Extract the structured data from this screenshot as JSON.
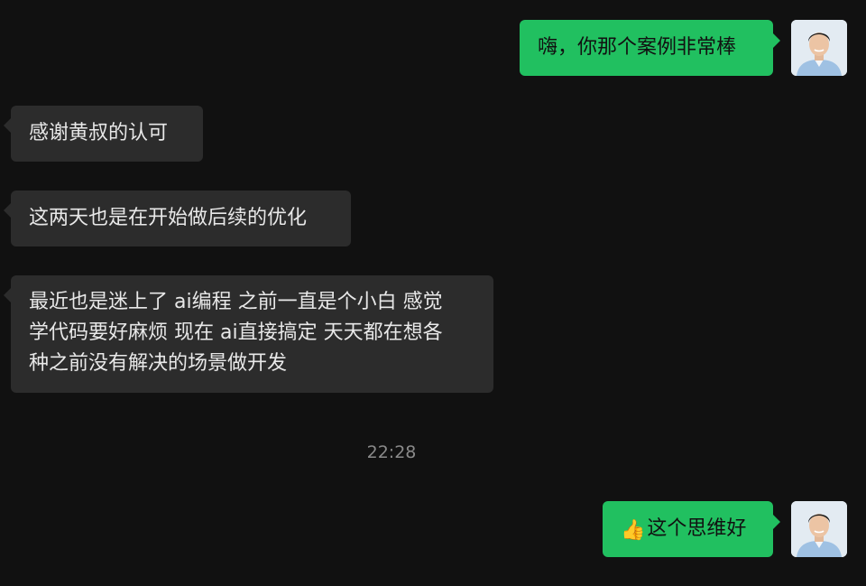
{
  "messages": [
    {
      "direction": "out",
      "text": "嗨，你那个案例非常棒"
    },
    {
      "direction": "in",
      "text": "感谢黄叔的认可"
    },
    {
      "direction": "in",
      "text": "这两天也是在开始做后续的优化"
    },
    {
      "direction": "in",
      "lines": [
        "最近也是迷上了 ai编程 之前一直是个小白 感觉",
        "学代码要好麻烦 现在 ai直接搞定 天天都在想各",
        "种之前没有解决的场景做开发"
      ]
    },
    {
      "direction": "out",
      "emoji": "👍",
      "text": "这个思维好"
    }
  ],
  "timestamp": "22:28",
  "colors": {
    "background": "#111111",
    "incoming_bubble": "#2c2c2c",
    "outgoing_bubble": "#21c060",
    "timestamp_text": "#8a8a8a"
  },
  "icons": [
    "user-avatar",
    "thumbs-up-emoji"
  ]
}
